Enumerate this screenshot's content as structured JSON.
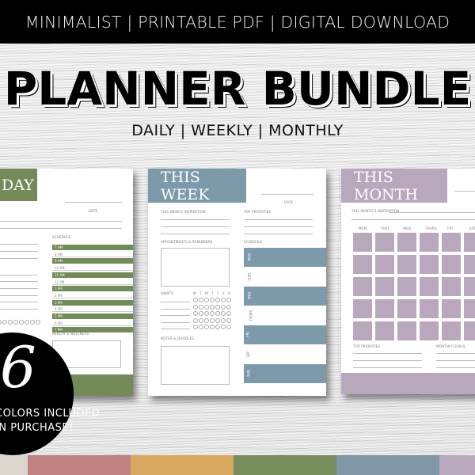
{
  "topbar": {
    "text": "MINIMALIST | PRINTABLE PDF | DIGITAL DOWNLOAD"
  },
  "headline": "PLANNER BUNDLE",
  "subhead": "DAILY | WEEKLY | MONTHLY",
  "daily": {
    "title": "DAY",
    "date_label": "DATE",
    "schedule_label": "SCHEDULE",
    "times": [
      "7 AM",
      "8 AM",
      "9 AM",
      "10 AM",
      "11 AM",
      "12 PM",
      "1 PM",
      "2 PM",
      "3 PM",
      "4 PM",
      "5 PM",
      "6 PM",
      "7 PM"
    ],
    "health_label": "HEALTH & WELLNESS",
    "color": "#738b59"
  },
  "weekly": {
    "title": "THIS WEEK",
    "date_label": "DATE",
    "inspiration_label": "THIS WEEK'S INSPIRATION",
    "priorities_label": "TOP PRIORITIES",
    "appointments_label": "APPOINTMENTS & REMINDERS",
    "schedule_label": "SCHEDULE",
    "habits_label": "HABITS",
    "habit_days": "M T W T F S S",
    "notes_label": "NOTES & DOODLES",
    "days": [
      "MON",
      "TUES",
      "WED",
      "THURS",
      "FRI",
      "SAT",
      "SUN"
    ],
    "color": "#7d9aab"
  },
  "monthly": {
    "title": "THIS MONTH",
    "inspiration_label": "THIS MONTH'S INSPIRATION",
    "weekdays": [
      "MON",
      "TUES",
      "WED",
      "THURS",
      "FRI",
      "SAT"
    ],
    "priorities_label": "TOP PRIORITIES",
    "goals_label": "MONTHLY GOALS",
    "color": "#b9a7bd"
  },
  "badge": {
    "number": "6",
    "line1": "COLORS INCLUDED",
    "line2": "IN PURCHASE!"
  },
  "swatches": [
    "#ddd6cf",
    "#bf8183",
    "#d8a861",
    "#778d5c",
    "#8097a5",
    "#b9a7bd"
  ]
}
